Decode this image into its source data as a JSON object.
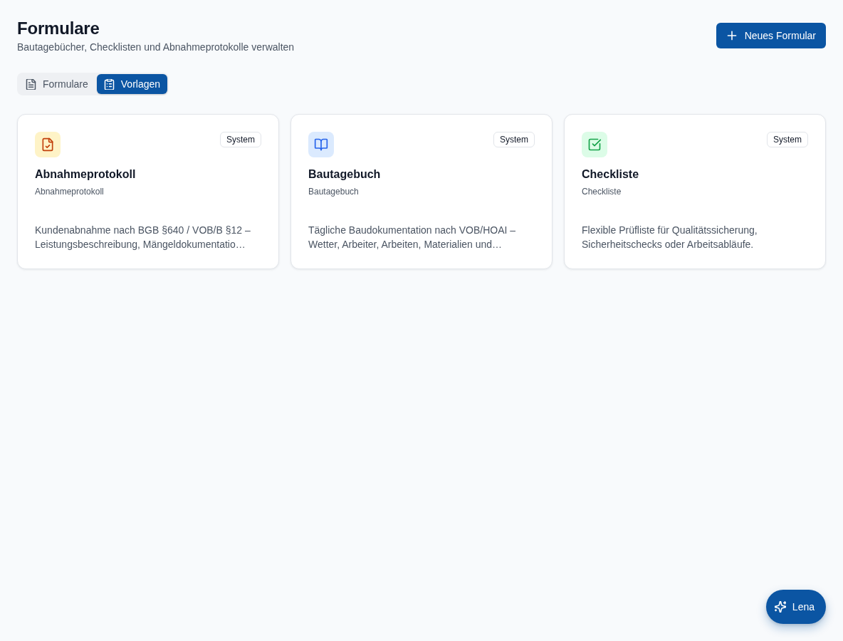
{
  "page": {
    "title": "Formulare",
    "subtitle": "Bautagebücher, Checklisten und Abnahmeprotokolle verwalten",
    "new_button": {
      "label": "Neues Formular"
    }
  },
  "tabs": [
    {
      "label": "Formulare",
      "kind": "document",
      "selected": false
    },
    {
      "label": "Vorlagen",
      "kind": "clipboard",
      "selected": true
    }
  ],
  "templates": [
    {
      "kind": "protocol",
      "color": "#fef3c7",
      "tag": "System",
      "title": "Abnahmeprotokoll",
      "subtitle": "Abnahmeprotokoll",
      "description": "Kundenabnahme nach BGB §640 / VOB/B §12 – Leistungsbeschreibung, Mängeldokumentatio…"
    },
    {
      "kind": "diary",
      "color": "#dbeafe",
      "tag": "System",
      "title": "Bautagebuch",
      "subtitle": "Bautagebuch",
      "description": "Tägliche Baudokumentation nach VOB/HOAI – Wetter, Arbeiter, Arbeiten, Materialien und…"
    },
    {
      "kind": "checklist",
      "color": "#dcfce7",
      "tag": "System",
      "title": "Checkliste",
      "subtitle": "Checkliste",
      "description": "Flexible Prüfliste für Qualitätssicherung, Sicherheitschecks oder Arbeitsabläufe."
    }
  ],
  "assistant_button": {
    "label": "Lena"
  }
}
